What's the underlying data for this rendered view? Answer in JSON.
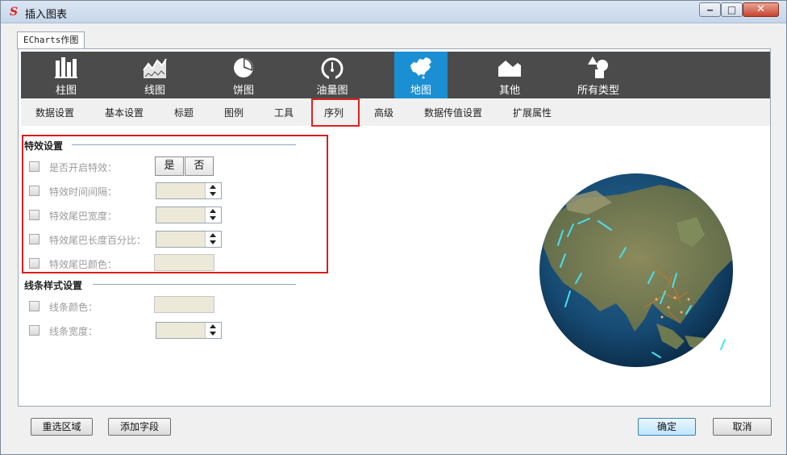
{
  "window": {
    "title": "插入图表"
  },
  "top_tab": "ECharts作图",
  "chart_types": [
    {
      "label": "柱图",
      "icon": "bar-chart-icon"
    },
    {
      "label": "线图",
      "icon": "line-chart-icon"
    },
    {
      "label": "饼图",
      "icon": "pie-chart-icon"
    },
    {
      "label": "油量图",
      "icon": "gauge-icon"
    },
    {
      "label": "地图",
      "icon": "china-map-icon",
      "active": true
    },
    {
      "label": "其他",
      "icon": "mountain-icon"
    },
    {
      "label": "所有类型",
      "icon": "shapes-icon"
    }
  ],
  "sub_tabs": [
    "数据设置",
    "基本设置",
    "标题",
    "图例",
    "工具",
    "序列",
    "高级",
    "数据传值设置",
    "扩展属性"
  ],
  "active_sub_tab": "序列",
  "effect_section": {
    "title": "特效设置",
    "fields": {
      "enable": "是否开启特效：",
      "interval": "特效时间间隔：",
      "tail_width": "特效尾巴宽度：",
      "tail_length": "特效尾巴长度百分比：",
      "tail_color": "特效尾巴颜色："
    },
    "yes": "是",
    "no": "否"
  },
  "line_section": {
    "title": "线条样式设置",
    "fields": {
      "color": "线条颜色：",
      "width": "线条宽度："
    }
  },
  "footer": {
    "reselect": "重选区域",
    "add_field": "添加字段",
    "ok": "确定",
    "cancel": "取消"
  },
  "colors": {
    "accent": "#1b8fd3",
    "highlight": "#e02020",
    "ocean": "#15466e"
  }
}
